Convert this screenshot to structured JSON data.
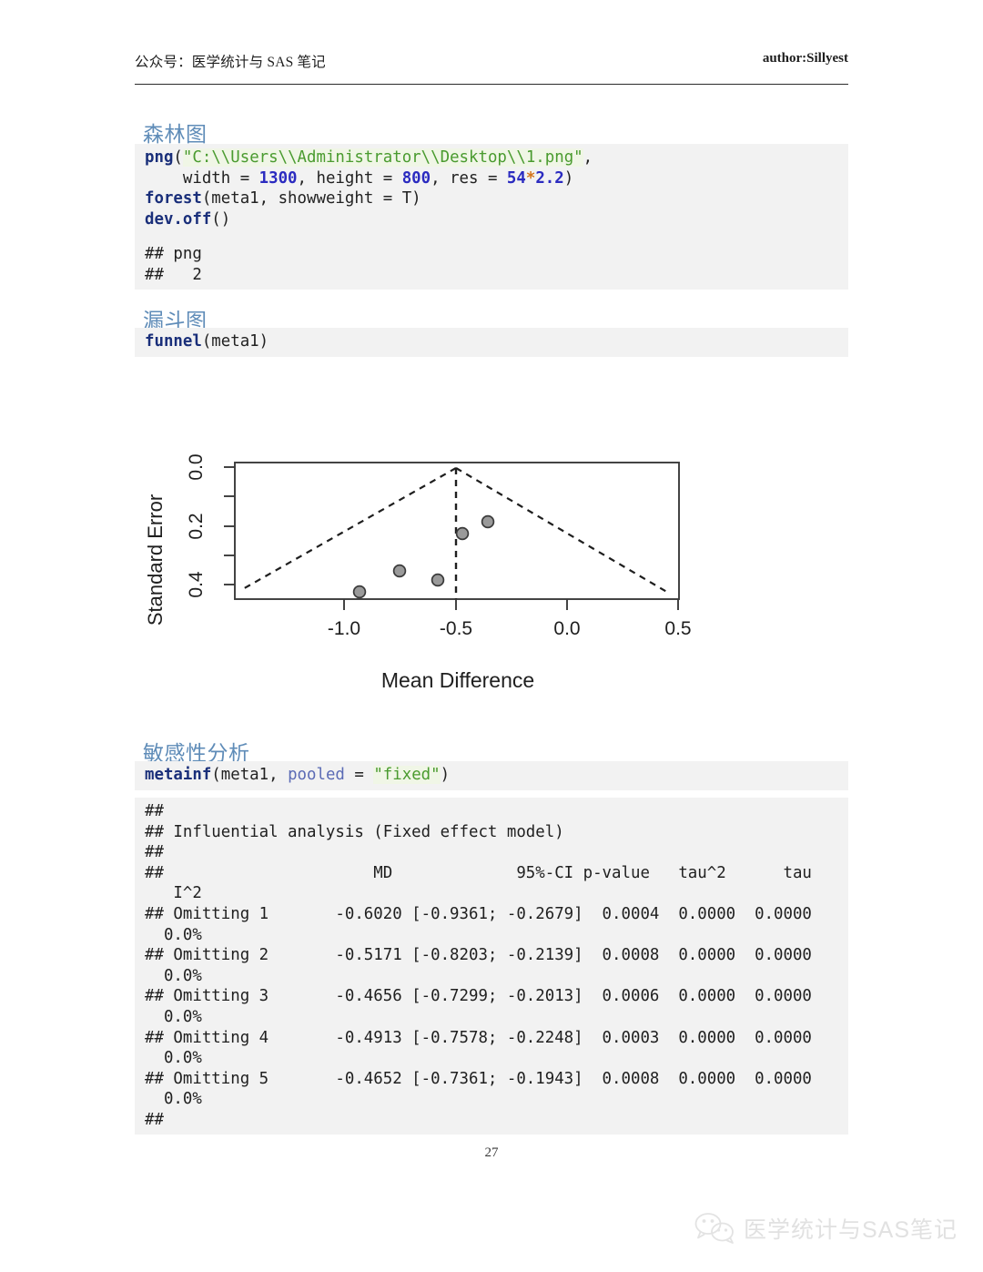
{
  "header": {
    "left": "公众号：医学统计与 SAS 笔记",
    "right": "author:Sillyest"
  },
  "sections": {
    "forest": {
      "heading": "森林图",
      "code_lines": [
        "png(\"C:\\\\Users\\\\Administrator\\\\Desktop\\\\1.png\",",
        "    width = 1300, height = 800, res = 54*2.2)",
        "forest(meta1, showweight = T)",
        "dev.off()"
      ],
      "output_lines": [
        "## png",
        "##   2"
      ]
    },
    "funnel": {
      "heading": "漏斗图",
      "code_lines": [
        "funnel(meta1)"
      ]
    },
    "sensitivity": {
      "heading": "敏感性分析",
      "code_lines": [
        "metainf(meta1, pooled = \"fixed\")"
      ],
      "output_lines": [
        "## ",
        "## Influential analysis (Fixed effect model)",
        "## ",
        "##                      MD             95%-CI p-value   tau^2      tau",
        "   I^2",
        "## Omitting 1       -0.6020 [-0.9361; -0.2679]  0.0004  0.0000  0.0000",
        "  0.0%",
        "## Omitting 2       -0.5171 [-0.8203; -0.2139]  0.0008  0.0000  0.0000",
        "  0.0%",
        "## Omitting 3       -0.4656 [-0.7299; -0.2013]  0.0006  0.0000  0.0000",
        "  0.0%",
        "## Omitting 4       -0.4913 [-0.7578; -0.2248]  0.0003  0.0000  0.0000",
        "  0.0%",
        "## Omitting 5       -0.4652 [-0.7361; -0.1943]  0.0008  0.0000  0.0000",
        "  0.0%",
        "## "
      ],
      "table": {
        "columns": [
          "",
          "MD",
          "95%-CI",
          "p-value",
          "tau^2",
          "tau",
          "I^2"
        ],
        "rows": [
          [
            "Omitting 1",
            "-0.6020",
            "[-0.9361; -0.2679]",
            "0.0004",
            "0.0000",
            "0.0000",
            "0.0%"
          ],
          [
            "Omitting 2",
            "-0.5171",
            "[-0.8203; -0.2139]",
            "0.0008",
            "0.0000",
            "0.0000",
            "0.0%"
          ],
          [
            "Omitting 3",
            "-0.4656",
            "[-0.7299; -0.2013]",
            "0.0006",
            "0.0000",
            "0.0000",
            "0.0%"
          ],
          [
            "Omitting 4",
            "-0.4913",
            "[-0.7578; -0.2248]",
            "0.0003",
            "0.0000",
            "0.0000",
            "0.0%"
          ],
          [
            "Omitting 5",
            "-0.4652",
            "[-0.7361; -0.1943]",
            "0.0008",
            "0.0000",
            "0.0000",
            "0.0%"
          ]
        ]
      }
    }
  },
  "chart_data": {
    "type": "scatter",
    "title": "",
    "xlabel": "Mean Difference",
    "ylabel": "Standard Error",
    "xlim": [
      -1.33,
      0.62
    ],
    "ylim": [
      0.0,
      0.47
    ],
    "y_inverted": true,
    "grid": false,
    "legend": null,
    "x_ticks": [
      -1.0,
      -0.5,
      0.0,
      0.5
    ],
    "x_tick_labels": [
      "-1.0",
      "-0.5",
      "0.0",
      "0.5"
    ],
    "y_ticks": [
      0.0,
      0.1,
      0.2,
      0.3,
      0.4
    ],
    "y_tick_labels": [
      "0.0",
      "",
      "0.2",
      "",
      "0.4"
    ],
    "points": [
      {
        "x": -0.93,
        "y": 0.445
      },
      {
        "x": -0.755,
        "y": 0.375
      },
      {
        "x": -0.585,
        "y": 0.405
      },
      {
        "x": -0.475,
        "y": 0.245
      },
      {
        "x": -0.365,
        "y": 0.205
      }
    ],
    "reference_line": {
      "x": -0.5,
      "style": "dashed",
      "label": "pooled estimate"
    },
    "funnel_lines": {
      "style": "dashed",
      "apex": {
        "x": -0.5,
        "y": 0.0
      },
      "left_end": {
        "x": -1.31,
        "y": 0.42
      },
      "right_end": {
        "x": 0.42,
        "y": 0.435
      }
    },
    "marker": {
      "shape": "circle",
      "fill": "#9a9a9a",
      "edge": "#3a3a3a",
      "size": 7
    }
  },
  "footer": {
    "page_number": "27",
    "watermark_text": "医学统计与SAS笔记",
    "watermark_icon": "wechat-icon"
  }
}
